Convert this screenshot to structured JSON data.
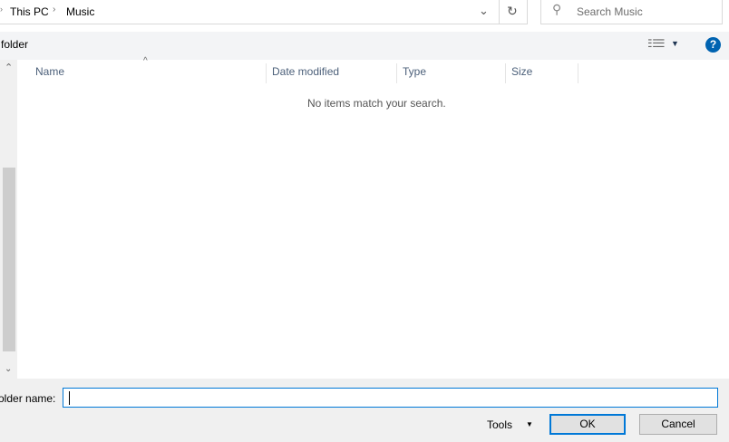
{
  "address": {
    "breadcrumb": [
      "This PC",
      "Music"
    ],
    "search_placeholder": "Search Music"
  },
  "toolbar": {
    "new_folder_label": "folder"
  },
  "columns": [
    "Name",
    "Date modified",
    "Type",
    "Size"
  ],
  "empty_message": "No items match your search.",
  "footer": {
    "folder_name_label": "older name:",
    "folder_name_value": "",
    "tools_label": "Tools",
    "ok_label": "OK",
    "cancel_label": "Cancel"
  },
  "colors": {
    "accent": "#0078d7",
    "help": "#0063b1"
  }
}
